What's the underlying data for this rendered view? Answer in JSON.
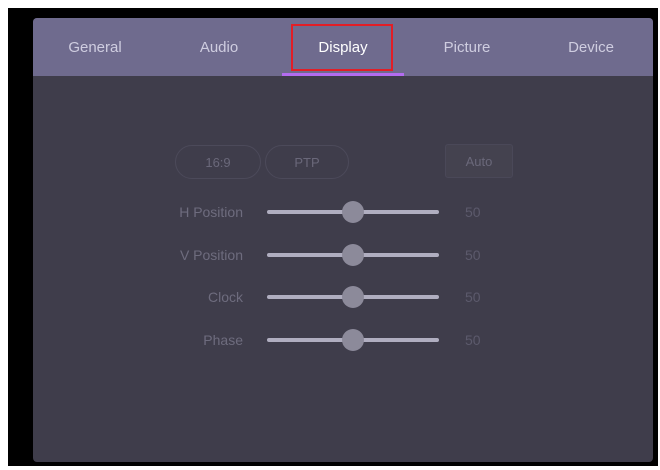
{
  "tabs": [
    {
      "label": "General",
      "active": false
    },
    {
      "label": "Audio",
      "active": false
    },
    {
      "label": "Display",
      "active": true
    },
    {
      "label": "Picture",
      "active": false
    },
    {
      "label": "Device",
      "active": false
    }
  ],
  "display": {
    "aspect_options": [
      "16:9",
      "PTP"
    ],
    "auto_label": "Auto",
    "rows": [
      {
        "label": "H Position",
        "value": "50",
        "level": 50
      },
      {
        "label": "V Position",
        "value": "50",
        "level": 50
      },
      {
        "label": "Clock",
        "value": "50",
        "level": 50
      },
      {
        "label": "Phase",
        "value": "50",
        "level": 50
      }
    ]
  },
  "colors": {
    "panel_bg": "#3f3d4b",
    "tabbar_bg": "#6f6b8e",
    "tab_indicator": "#b36cf0",
    "highlight_box": "#e21e26"
  }
}
